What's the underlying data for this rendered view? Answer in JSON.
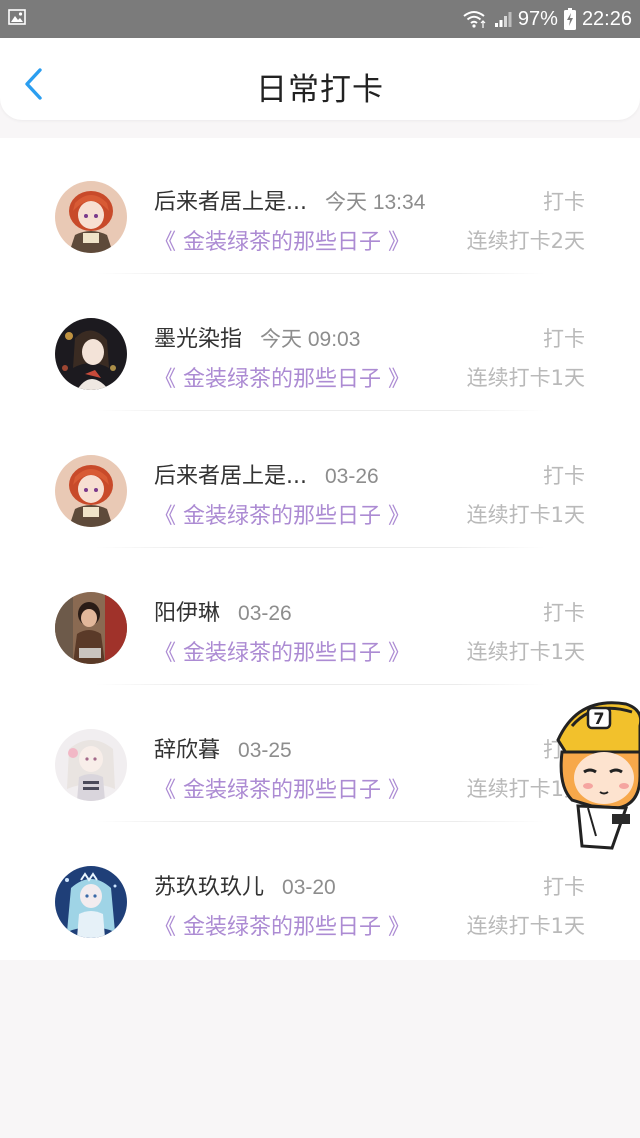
{
  "status_bar": {
    "battery": "97%",
    "time": "22:26"
  },
  "header": {
    "title": "日常打卡"
  },
  "colors": {
    "accent_blue": "#2b9ef0",
    "book_purple": "#ac8bd3",
    "muted_gray": "#b9b9b9"
  },
  "items": [
    {
      "name": "后来者居上是...",
      "time": "今天 13:34",
      "book": "《 金装绿茶的那些日子 》",
      "action": "打卡",
      "streak": "连续打卡2天"
    },
    {
      "name": "墨光染指",
      "time": "今天 09:03",
      "book": "《 金装绿茶的那些日子 》",
      "action": "打卡",
      "streak": "连续打卡1天"
    },
    {
      "name": "后来者居上是...",
      "time": "03-26",
      "book": "《 金装绿茶的那些日子 》",
      "action": "打卡",
      "streak": "连续打卡1天"
    },
    {
      "name": "阳伊琳",
      "time": "03-26",
      "book": "《 金装绿茶的那些日子 》",
      "action": "打卡",
      "streak": "连续打卡1天"
    },
    {
      "name": "辞欣暮",
      "time": "03-25",
      "book": "《 金装绿茶的那些日子 》",
      "action": "打卡",
      "streak": "连续打卡1天"
    },
    {
      "name": "苏玖玖玖儿",
      "time": "03-20",
      "book": "《 金装绿茶的那些日子 》",
      "action": "打卡",
      "streak": "连续打卡1天"
    }
  ]
}
